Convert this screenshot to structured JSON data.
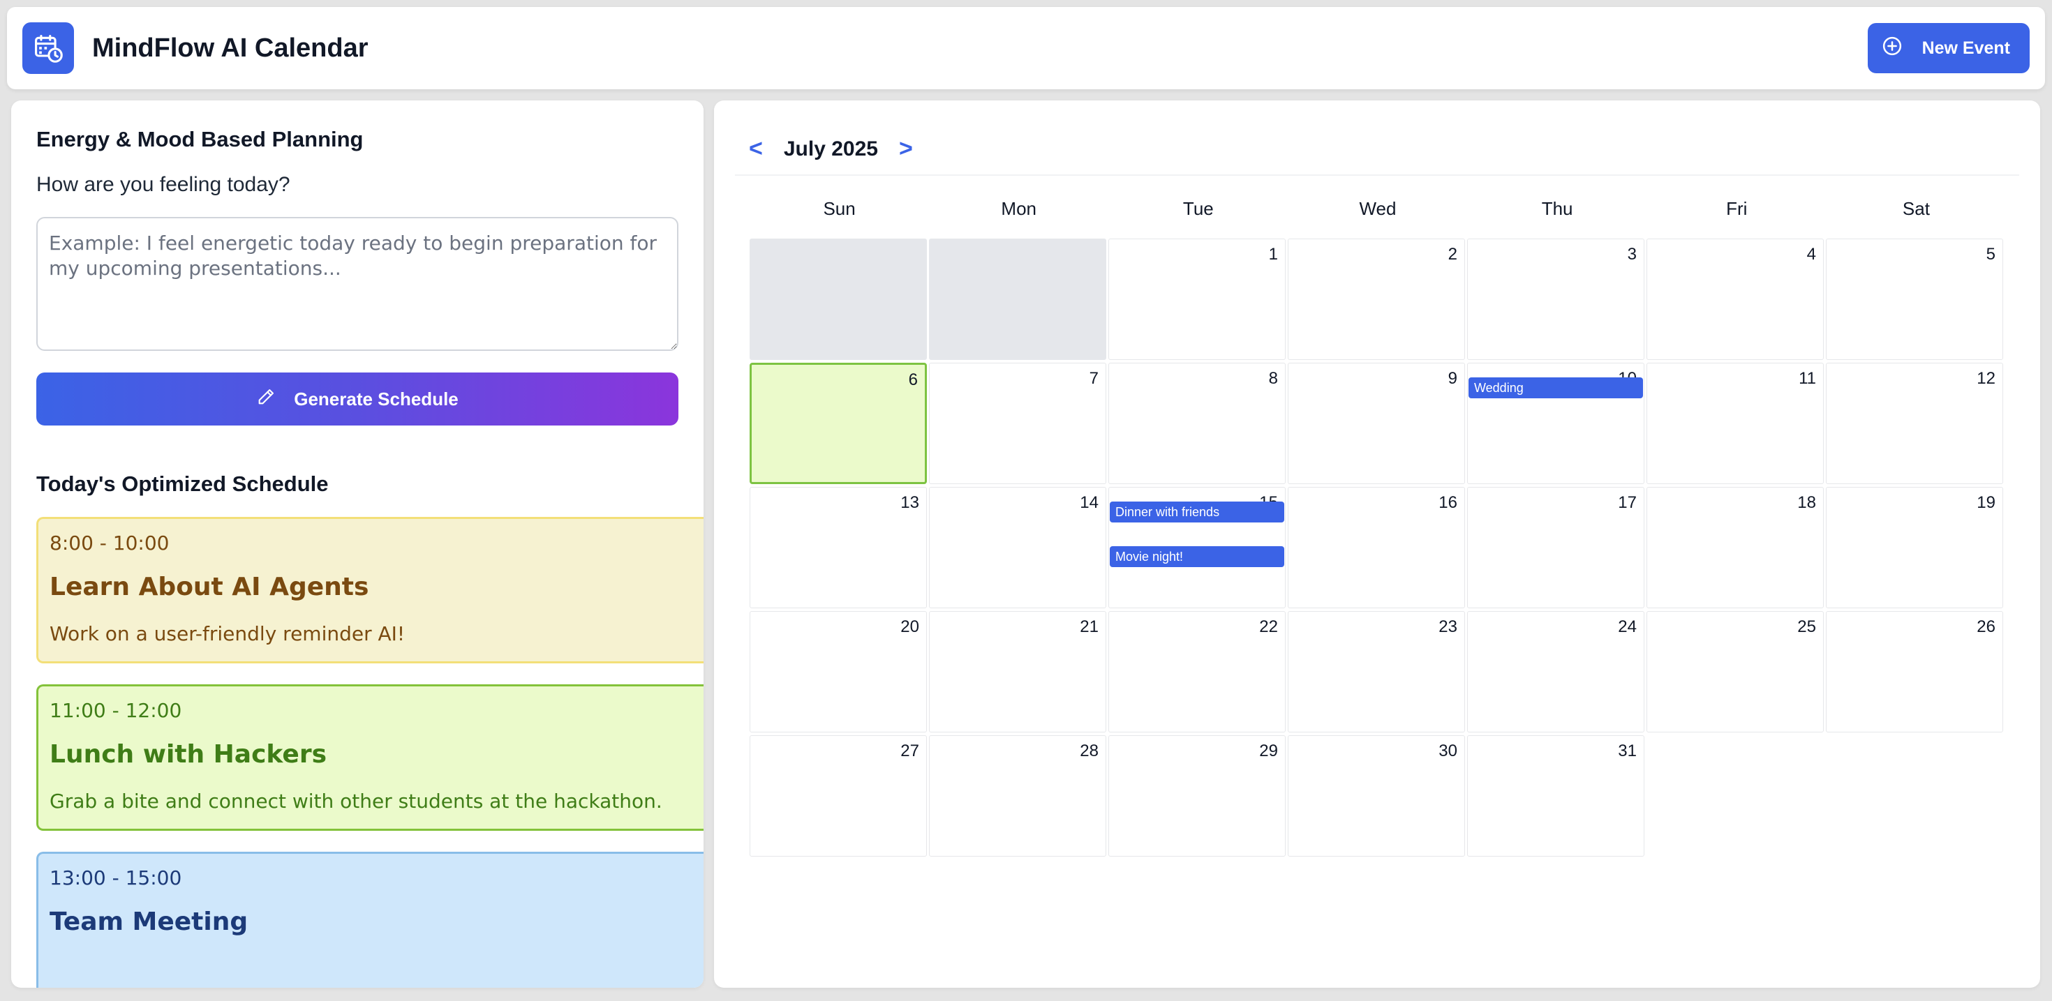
{
  "header": {
    "title": "MindFlow AI Calendar",
    "new_event_label": "New Event"
  },
  "planner": {
    "section_title": "Energy & Mood Based Planning",
    "prompt": "How are you feeling today?",
    "input_placeholder": "Example: I feel energetic today ready to begin preparation for my upcoming presentations...",
    "generate_label": "Generate Schedule"
  },
  "schedule": {
    "title": "Today's Optimized Schedule",
    "items": [
      {
        "time": "8:00 - 10:00",
        "title": "Learn About AI Agents",
        "desc": "Work on a user-friendly reminder AI!"
      },
      {
        "time": "11:00 - 12:00",
        "title": "Lunch with Hackers",
        "desc": "Grab a bite and connect with other students at the hackathon."
      },
      {
        "time": "13:00 - 15:00",
        "title": "Team Meeting",
        "desc": ""
      }
    ]
  },
  "calendar": {
    "prev": "<",
    "next": ">",
    "month_label": "July 2025",
    "weekdays": [
      "Sun",
      "Mon",
      "Tue",
      "Wed",
      "Thu",
      "Fri",
      "Sat"
    ],
    "leading_empty_days": 2,
    "days_in_month": 31,
    "today": 6,
    "events": [
      {
        "day": 10,
        "title": "Wedding"
      },
      {
        "day": 15,
        "title": "Dinner with friends"
      },
      {
        "day": 15,
        "title": "Movie night!"
      }
    ]
  },
  "colors": {
    "accent": "#3b63e6",
    "gradient_end": "#8b35dc",
    "today_bg": "#ebfacb",
    "today_border": "#7dc342"
  }
}
